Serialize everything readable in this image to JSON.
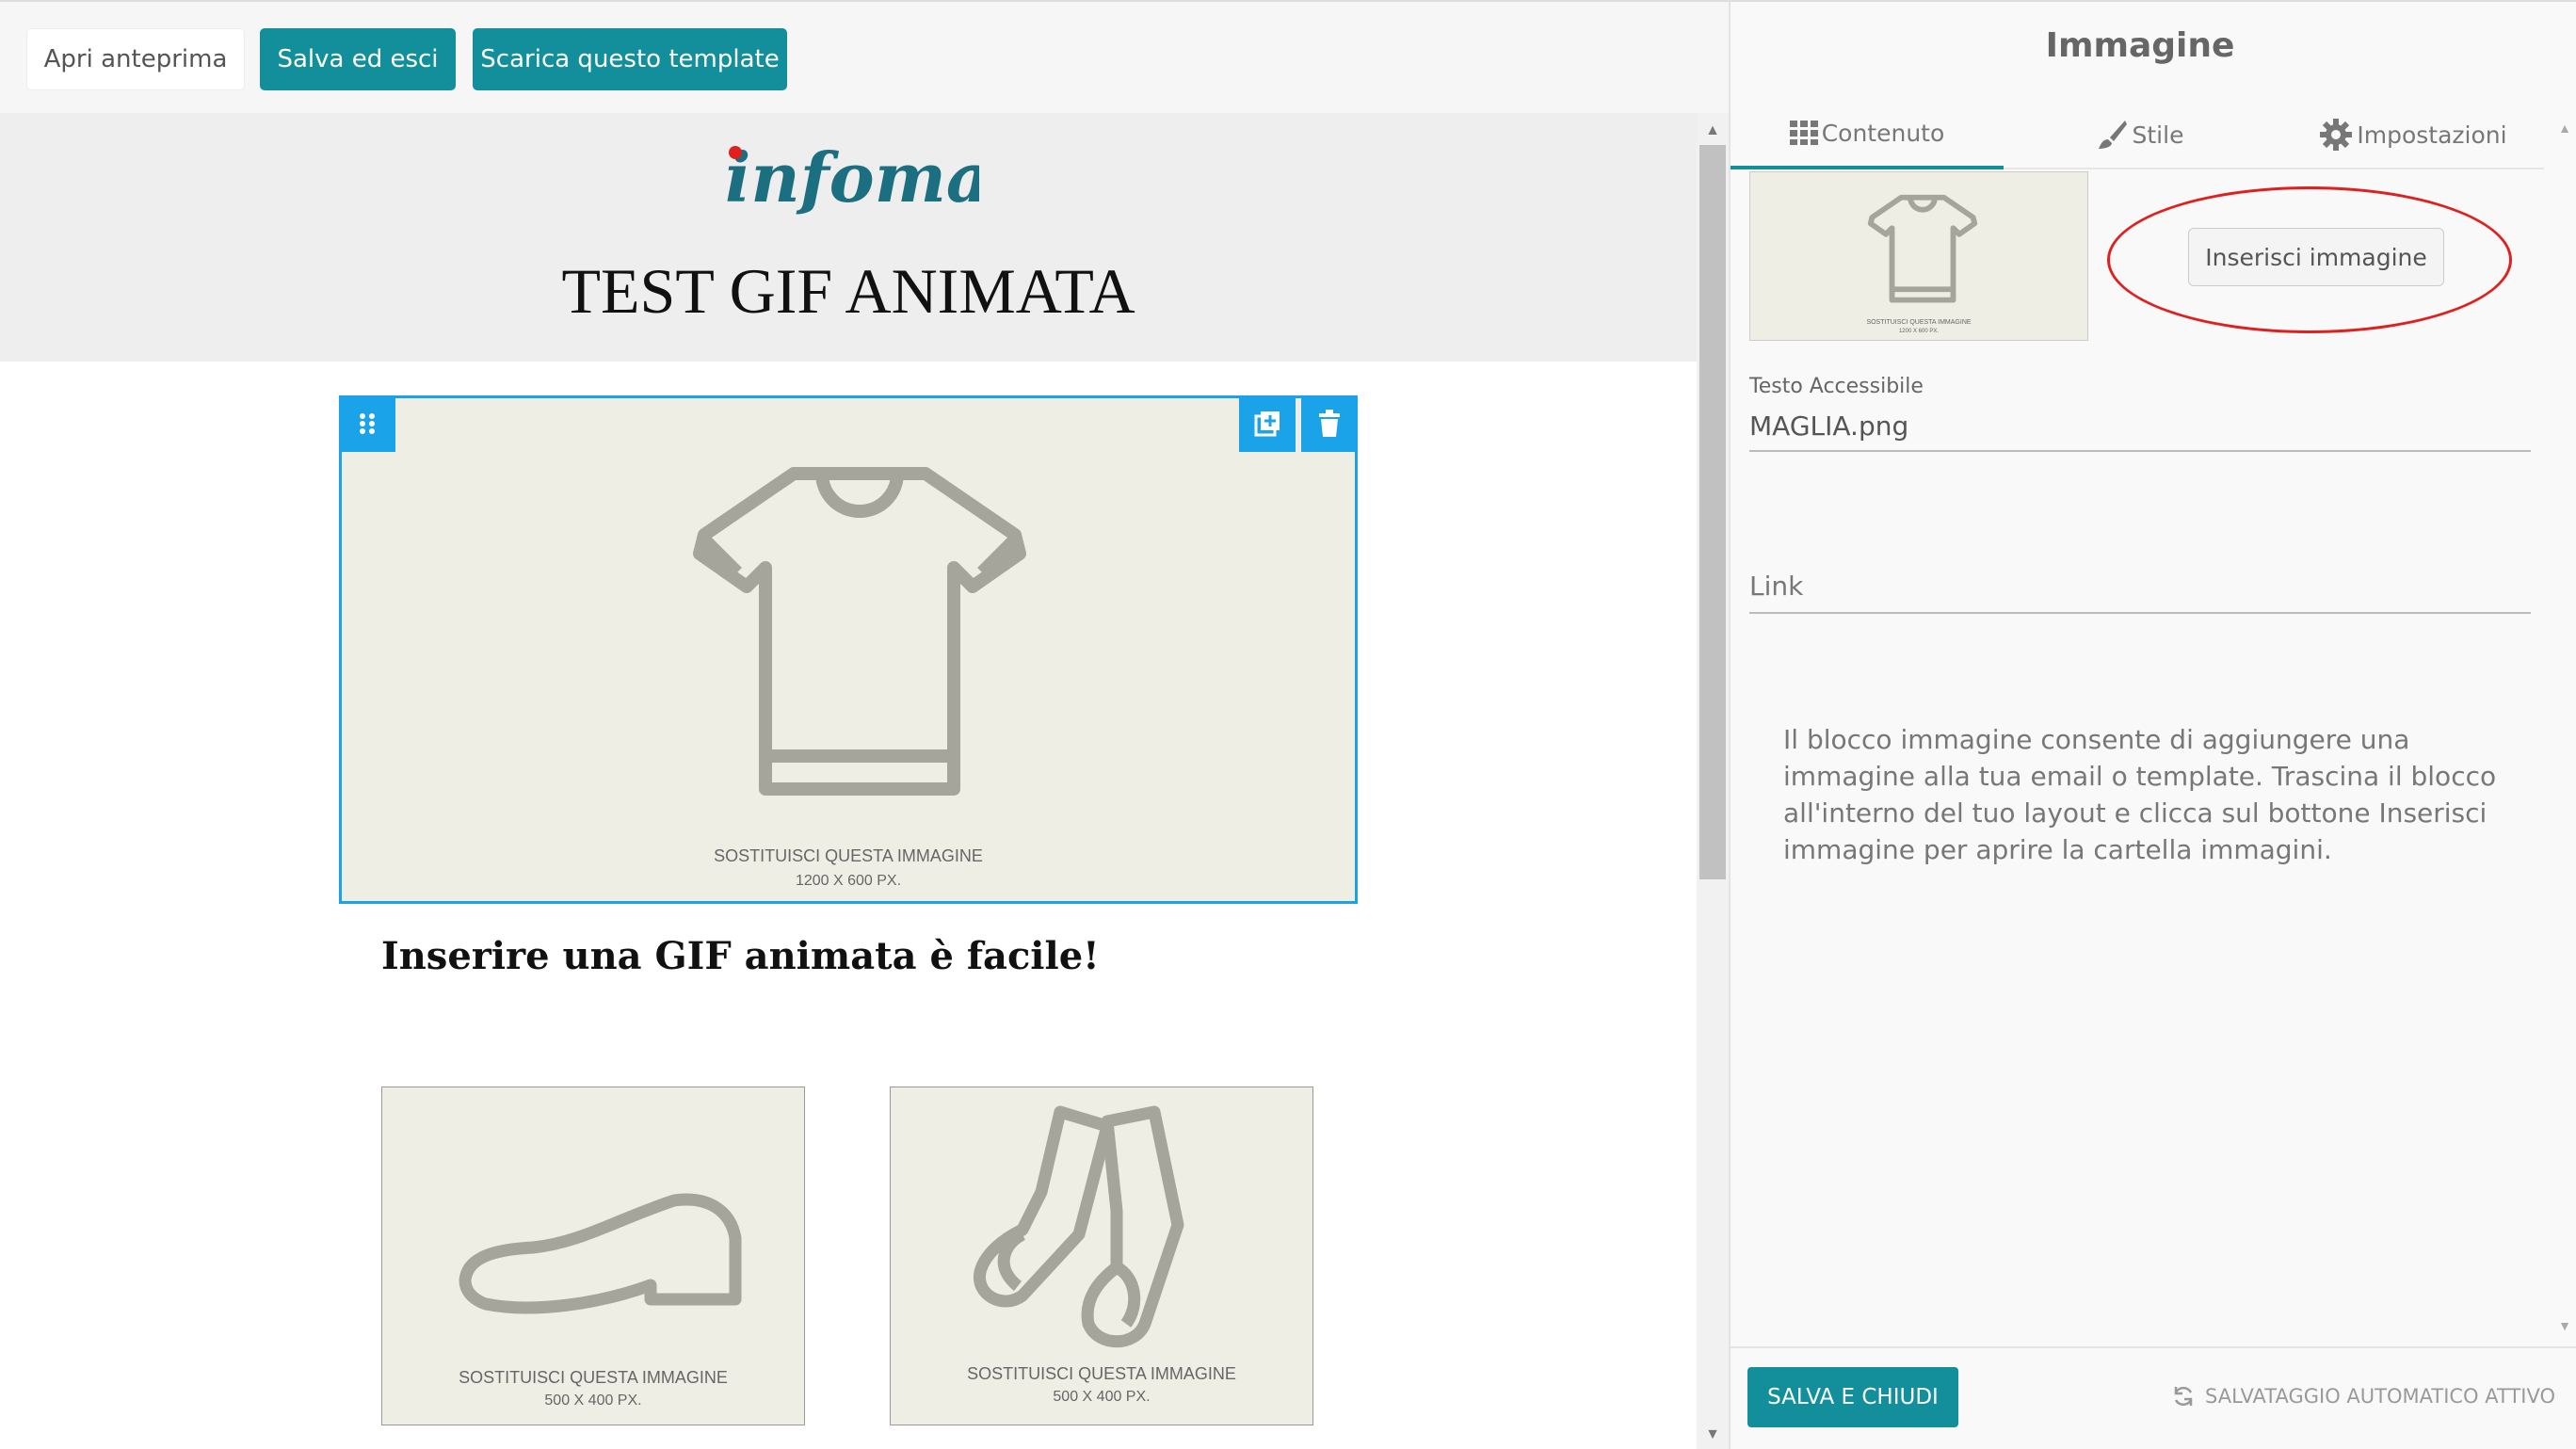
{
  "toolbar": {
    "preview_label": "Apri anteprima",
    "save_exit_label": "Salva ed esci",
    "download_label": "Scarica questo template"
  },
  "email": {
    "logo_text": "infomail",
    "title": "TEST GIF ANIMATA",
    "hero_caption_line1": "SOSTITUISCI QUESTA IMMAGINE",
    "hero_caption_line2": "1200 X 600 PX.",
    "subtitle": "Inserire una GIF animata è facile!",
    "shoe_caption_line1": "SOSTITUISCI QUESTA IMMAGINE",
    "shoe_caption_line2": "500 X 400 PX.",
    "socks_caption_line1": "SOSTITUISCI QUESTA IMMAGINE",
    "socks_caption_line2": "500 X 400 PX."
  },
  "panel": {
    "title": "Immagine",
    "tabs": [
      {
        "label": "Contenuto",
        "icon": "grid-icon",
        "active": true
      },
      {
        "label": "Stile",
        "icon": "brush-icon",
        "active": false
      },
      {
        "label": "Impostazioni",
        "icon": "gear-icon",
        "active": false
      }
    ],
    "thumb_caption_line1": "SOSTITUISCI QUESTA IMMAGINE",
    "thumb_caption_line2": "1200 X 600 PX.",
    "insert_button": "Inserisci immagine",
    "alt_label": "Testo Accessibile",
    "alt_value": "MAGLIA.png",
    "link_placeholder": "Link",
    "help_text": "Il blocco immagine consente di aggiungere una immagine alla tua email o template. Trascina il blocco all'interno del tuo layout e clicca sul bottone Inserisci immagine per aprire la cartella immagini.",
    "save_close": "SALVA E CHIUDI",
    "autosave": "SALVATAGGIO AUTOMATICO ATTIVO"
  },
  "colors": {
    "accent": "#138f9b",
    "selection": "#1aa3e8",
    "highlight": "#e0201f",
    "placeholder_bg": "#eeeee4",
    "logo_dot": "#e0201f",
    "logo_text": "#1b6f80"
  }
}
